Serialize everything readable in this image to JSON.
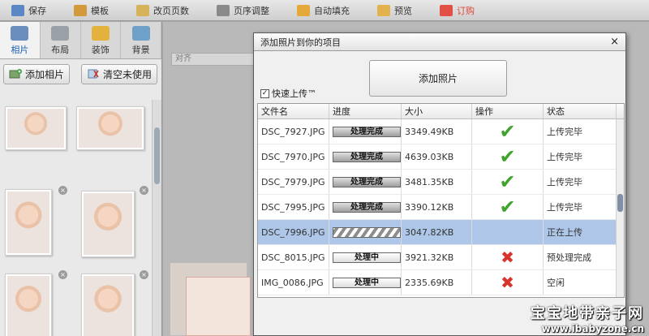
{
  "toolbar": {
    "items": [
      {
        "label": "保存",
        "icon": "save-icon",
        "color": "#5b87c5"
      },
      {
        "label": "模板",
        "icon": "template-icon",
        "color": "#d29a3a"
      },
      {
        "label": "改页页数",
        "icon": "page-count-icon",
        "color": "#d6b25a"
      },
      {
        "label": "页序调整",
        "icon": "page-order-icon",
        "color": "#8a8a8a"
      },
      {
        "label": "自动填充",
        "icon": "auto-fill-icon",
        "color": "#e5a83b"
      },
      {
        "label": "预览",
        "icon": "preview-icon",
        "color": "#e2b24c"
      },
      {
        "label": "订购",
        "icon": "order-icon",
        "color": "#e25045"
      }
    ]
  },
  "sidebar": {
    "tabs": [
      {
        "label": "相片",
        "active": true,
        "icon": "photo-tab-icon"
      },
      {
        "label": "布局",
        "active": false,
        "icon": "layout-tab-icon"
      },
      {
        "label": "装饰",
        "active": false,
        "icon": "decor-tab-icon"
      },
      {
        "label": "背景",
        "active": false,
        "icon": "background-tab-icon"
      }
    ],
    "add_photo_label": "添加相片",
    "clear_unused_label": "清空未使用"
  },
  "canvas": {
    "align_label": "对齐"
  },
  "dialog": {
    "title": "添加照片到你的项目",
    "close_symbol": "×",
    "add_button_label": "添加照片",
    "fast_upload_label": "快速上传™",
    "fast_upload_checked": true,
    "columns": [
      "文件名",
      "进度",
      "大小",
      "操作",
      "状态"
    ],
    "rows": [
      {
        "file": "DSC_7927.JPG",
        "progress": "处理完成",
        "size": "3349.49KB",
        "op": "check",
        "status": "上传完毕",
        "selected": false
      },
      {
        "file": "DSC_7970.JPG",
        "progress": "处理完成",
        "size": "4639.03KB",
        "op": "check",
        "status": "上传完毕",
        "selected": false
      },
      {
        "file": "DSC_7979.JPG",
        "progress": "处理完成",
        "size": "3481.35KB",
        "op": "check",
        "status": "上传完毕",
        "selected": false
      },
      {
        "file": "DSC_7995.JPG",
        "progress": "处理完成",
        "size": "3390.12KB",
        "op": "check",
        "status": "上传完毕",
        "selected": false
      },
      {
        "file": "DSC_7996.JPG",
        "progress": "",
        "size": "3047.82KB",
        "op": "",
        "status": "正在上传",
        "selected": true
      },
      {
        "file": "DSC_8015.JPG",
        "progress": "处理中",
        "size": "3921.32KB",
        "op": "cross",
        "status": "预处理完成",
        "selected": false
      },
      {
        "file": "IMG_0086.JPG",
        "progress": "处理中",
        "size": "2335.69KB",
        "op": "cross",
        "status": "空闲",
        "selected": false
      }
    ]
  },
  "watermark": {
    "line1": "宝宝地带亲子网",
    "line2": "www.ibabyzone.cn"
  }
}
